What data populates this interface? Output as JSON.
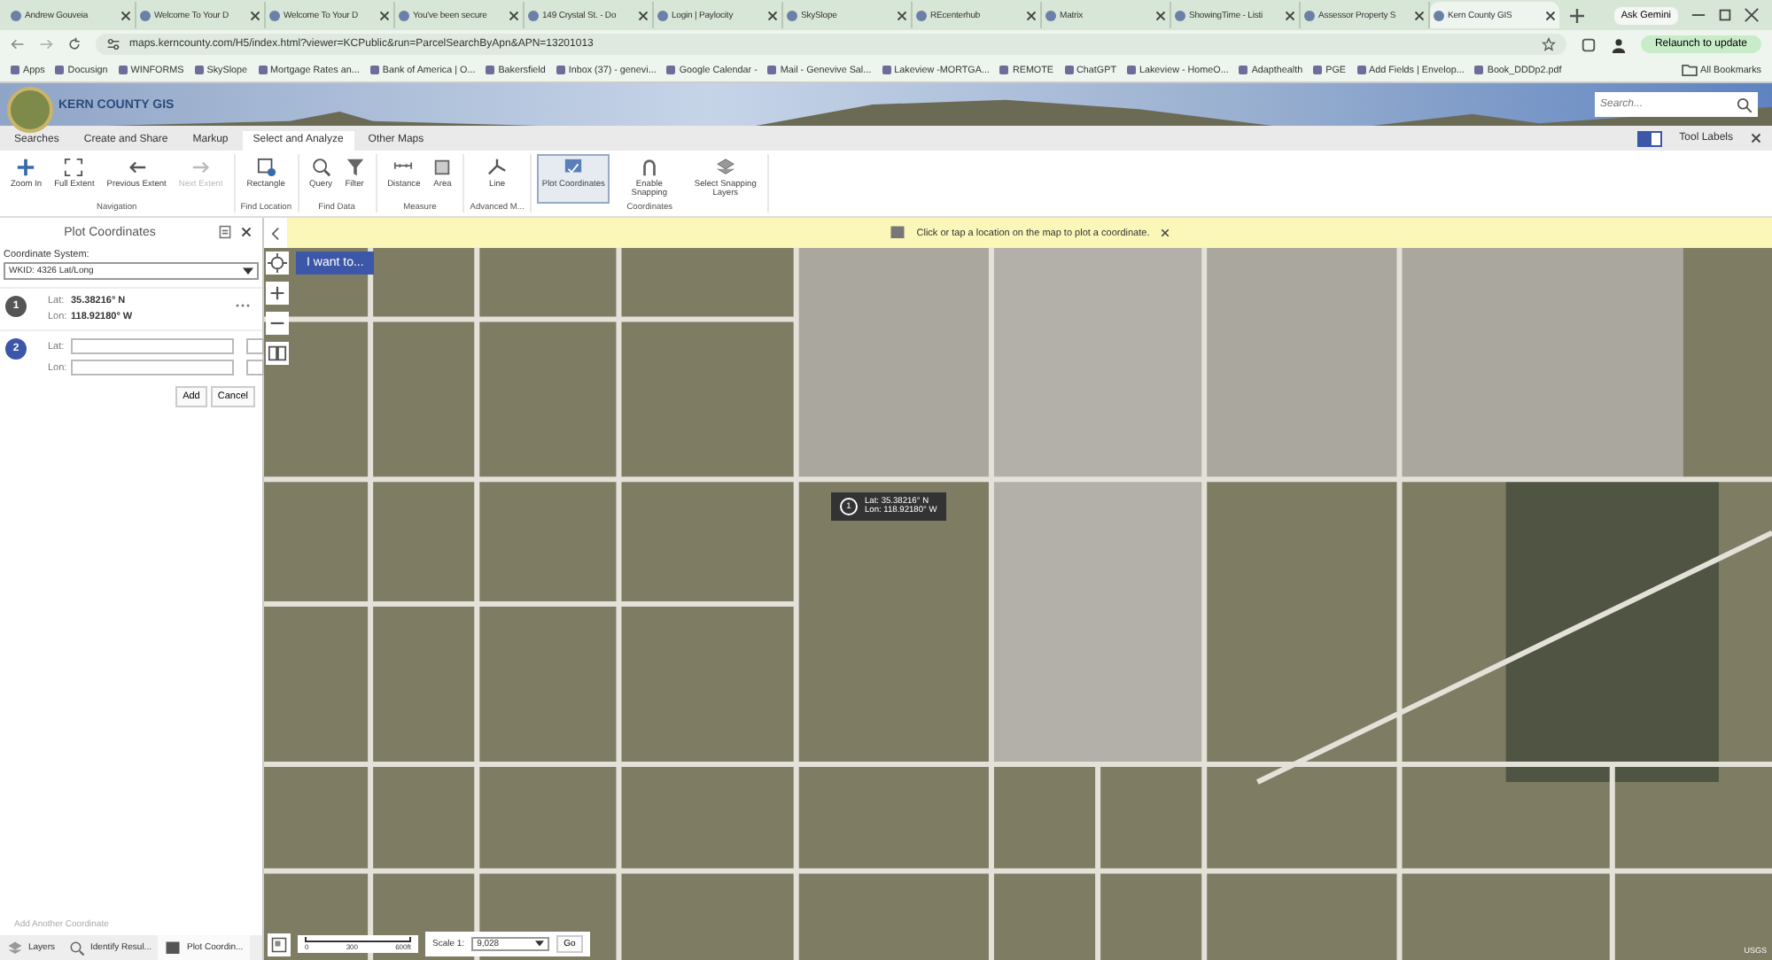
{
  "browser": {
    "tabs": [
      {
        "title": "Andrew Gouveia",
        "selected": false
      },
      {
        "title": "Welcome To Your D",
        "selected": false
      },
      {
        "title": "Welcome To Your D",
        "selected": false
      },
      {
        "title": "You've been secure",
        "selected": false
      },
      {
        "title": "149 Crystal St. - Do",
        "selected": false
      },
      {
        "title": "Login | Paylocity",
        "selected": false
      },
      {
        "title": "SkySlope",
        "selected": false
      },
      {
        "title": "REcenterhub",
        "selected": false
      },
      {
        "title": "Matrix",
        "selected": false
      },
      {
        "title": "ShowingTime - Listi",
        "selected": false
      },
      {
        "title": "Assessor Property S",
        "selected": false
      },
      {
        "title": "Kern County GIS",
        "selected": true
      }
    ],
    "ask_button": "Ask Gemini",
    "url": "maps.kerncounty.com/H5/index.html?viewer=KCPublic&run=ParcelSearchByApn&APN=13201013",
    "relaunch_button": "Relaunch to update",
    "bookmarks": [
      "Apps",
      "Docusign",
      "WINFORMS",
      "SkySlope",
      "Mortgage Rates an...",
      "Bank of America | O...",
      "Bakersfield",
      "Inbox (37) - genevi...",
      "Google Calendar -",
      "Mail - Genevive Sal...",
      "Lakeview -MORTGA...",
      "REMOTE",
      "ChatGPT",
      "Lakeview - HomeO...",
      "Adapthealth",
      "PGE",
      "Add Fields | Envelop...",
      "Book_DDDp2.pdf"
    ],
    "all_bookmarks": "All Bookmarks"
  },
  "banner": {
    "title": "KERN COUNTY GIS",
    "search_placeholder": "Search..."
  },
  "menu": {
    "tabs": [
      {
        "label": "Searches",
        "selected": false
      },
      {
        "label": "Create and Share",
        "selected": false
      },
      {
        "label": "Markup",
        "selected": false
      },
      {
        "label": "Select and Analyze",
        "selected": true
      },
      {
        "label": "Other Maps",
        "selected": false
      }
    ],
    "tool_labels": {
      "label": "Tool Labels",
      "on": true
    }
  },
  "ribbon": [
    {
      "group": "Navigation",
      "tools": [
        {
          "label": "Zoom In",
          "kind": "plus",
          "disabled": false,
          "selected": false
        },
        {
          "label": "Full Extent",
          "kind": "extent",
          "disabled": false,
          "selected": false
        },
        {
          "label": "Previous Extent",
          "kind": "back",
          "disabled": false,
          "selected": false
        },
        {
          "label": "Next Extent",
          "kind": "forward",
          "disabled": true,
          "selected": false
        }
      ]
    },
    {
      "group": "Find Location",
      "tools": [
        {
          "label": "Rectangle",
          "kind": "rectangle",
          "disabled": false,
          "selected": false
        }
      ]
    },
    {
      "group": "Find Data",
      "tools": [
        {
          "label": "Query",
          "kind": "query",
          "disabled": false,
          "selected": false
        },
        {
          "label": "Filter",
          "kind": "filter",
          "disabled": false,
          "selected": false
        }
      ]
    },
    {
      "group": "Measure",
      "tools": [
        {
          "label": "Distance",
          "kind": "ruler",
          "disabled": false,
          "selected": false
        },
        {
          "label": "Area",
          "kind": "area",
          "disabled": false,
          "selected": false
        }
      ]
    },
    {
      "group": "Advanced M...",
      "tools": [
        {
          "label": "Line",
          "kind": "line",
          "disabled": false,
          "selected": false
        }
      ]
    },
    {
      "group": "Coordinates",
      "tools": [
        {
          "label": "Plot Coordinates",
          "kind": "plot",
          "disabled": false,
          "selected": true
        },
        {
          "label": "Enable Snapping",
          "kind": "magnet",
          "disabled": false,
          "selected": false
        },
        {
          "label": "Select Snapping Layers",
          "kind": "layers",
          "disabled": false,
          "selected": false
        }
      ]
    }
  ],
  "panel": {
    "title": "Plot Coordinates",
    "system_label": "Coordinate System:",
    "system": "WKID: 4326 Lat/Long",
    "points": [
      {
        "number": "1",
        "kind": "plotted",
        "lat_label": "Lat:",
        "lat": "35.38216° N",
        "lon_label": "Lon:",
        "lon": "118.92180° W"
      },
      {
        "number": "2",
        "kind": "input",
        "lat_label": "Lat:",
        "lon_label": "Lon:"
      }
    ],
    "buttons": [
      "Add",
      "Cancel"
    ],
    "add_another": "Add Another Coordinate",
    "bottom_tabs": [
      {
        "label": "Layers",
        "kind": "layers",
        "selected": false
      },
      {
        "label": "Identify Resul...",
        "kind": "search",
        "selected": false
      },
      {
        "label": "Plot Coordin...",
        "kind": "plot",
        "selected": true
      }
    ]
  },
  "map": {
    "hint": "Click or tap a location on the map to plot a coordinate.",
    "i_want_to": "I want to...",
    "popup": {
      "number": "1",
      "lat": "Lat: 35.38216° N",
      "lon": "Lon: 118.92180° W"
    },
    "scale_bar": [
      "0",
      "300",
      "600ft"
    ],
    "scale_label": "Scale 1:",
    "scale_value": "9,028",
    "go": "Go",
    "attribution": "USGS"
  }
}
